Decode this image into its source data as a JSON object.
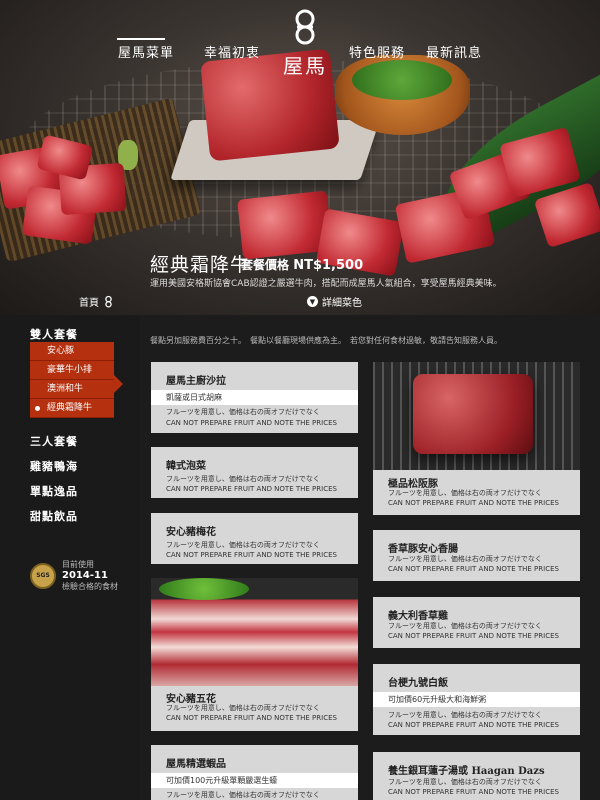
{
  "nav": {
    "items": [
      "屋馬菜單",
      "幸福初衷",
      "特色服務",
      "最新訊息"
    ],
    "logo_text": "屋馬"
  },
  "hero": {
    "title": "經典霜降牛",
    "price_label": "套餐價格",
    "price": "NT$1,500",
    "description": "運用美國安格斯協會CAB認證之嚴選牛肉，搭配而成屋馬人氣組合，享受屋馬經典美味。",
    "home_link": "首頁",
    "detail_link": "詳細菜色"
  },
  "sidebar": {
    "categories": [
      "雙人套餐",
      "三人套餐",
      "雞豬鴨海",
      "單點逸品",
      "甜點飲品"
    ],
    "submenu": [
      "安心豚",
      "豪華牛小排",
      "澳洲和牛",
      "經典霜降牛"
    ],
    "active_sub": "經典霜降牛",
    "badge_label": "目前使用",
    "badge_date": "2014-11",
    "badge_desc": "檢驗合格的食材",
    "badge_mark": "SGS"
  },
  "notice": "餐點另加服務費百分之十。　餐點以餐廳現場供應為主。　若您對任何食材過敏，敬請告知服務人員。",
  "note_jp": "フルーツを用意し、価格は右の両オフだけでなく",
  "note_en": "CAN NOT PREPARE FRUIT AND NOTE THE PRICES",
  "cards": {
    "c1": {
      "name": "屋馬主廚沙拉",
      "extra": "凱薩或日式胡麻"
    },
    "c2": {
      "name": "韓式泡菜"
    },
    "c3": {
      "name": "安心豬梅花"
    },
    "c4": {
      "name": "安心豬五花"
    },
    "c5": {
      "name": "屋馬精選蝦品",
      "extra": "可加價100元升級單顆嚴選生蠔"
    },
    "c6": {
      "name": "極品松阪豚"
    },
    "c7": {
      "name": "香草豚安心香腸"
    },
    "c8": {
      "name": "義大利香草雞"
    },
    "c9": {
      "name": "台梗九號白飯",
      "extra": "可加價60元升級大和海鮮粥"
    },
    "c10": {
      "name": "養生銀耳蓮子湯或 Haagan Dazs"
    }
  }
}
